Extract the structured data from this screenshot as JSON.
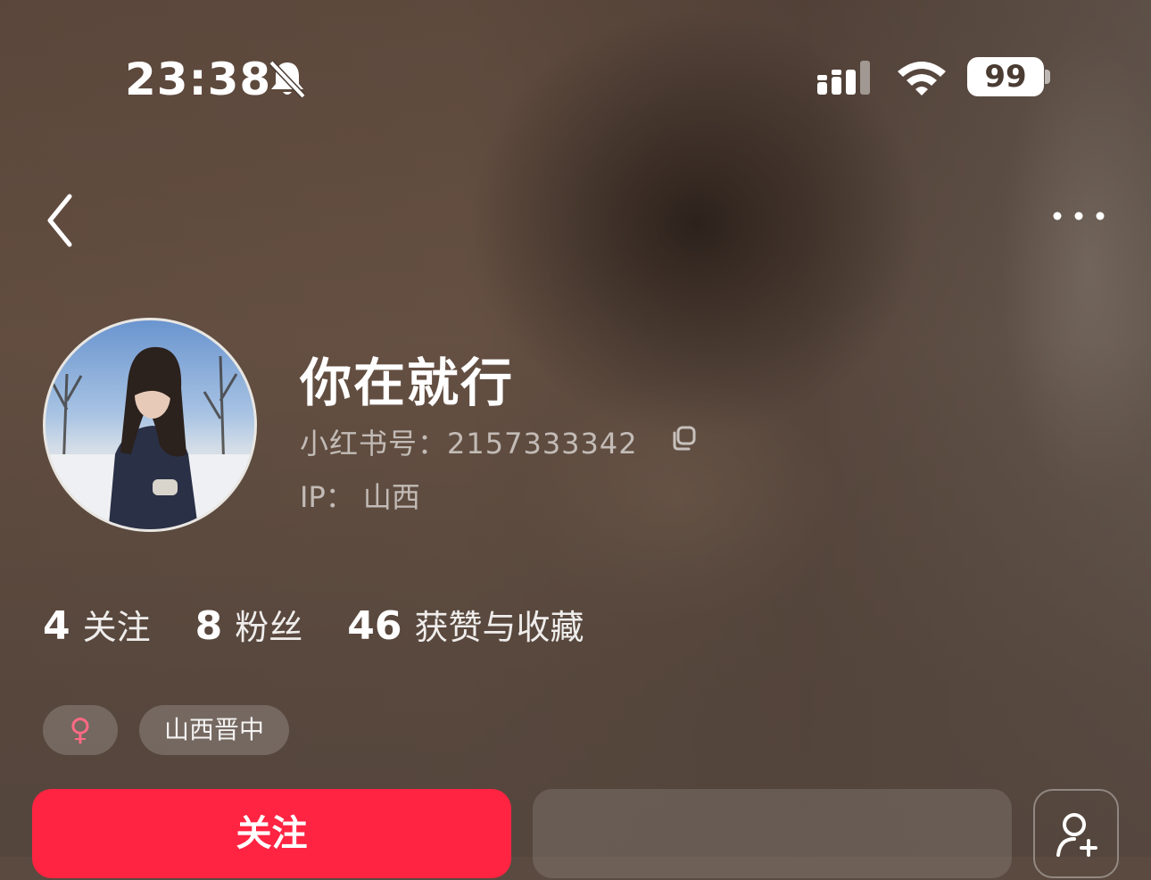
{
  "status_bar": {
    "time": "23:38",
    "battery": "99",
    "icons": [
      "bell-muted-icon",
      "signal-icon",
      "wifi-icon",
      "battery-icon"
    ]
  },
  "nav": {
    "back_icon": "chevron-left-icon",
    "more_icon": "more-horizontal-icon"
  },
  "profile": {
    "username": "你在就行",
    "redbook_id_label": "小红书号：",
    "redbook_id": "2157333342",
    "ip_label": "IP：",
    "ip_location": "山西"
  },
  "stats": [
    {
      "num": "4",
      "label": "关注"
    },
    {
      "num": "8",
      "label": "粉丝"
    },
    {
      "num": "46",
      "label": "获赞与收藏"
    }
  ],
  "tags": {
    "gender": "♀",
    "location": "山西晋中"
  },
  "actions": {
    "follow_label": "关注"
  },
  "colors": {
    "accent": "#ff2442",
    "gender_female": "#ff6a85"
  }
}
